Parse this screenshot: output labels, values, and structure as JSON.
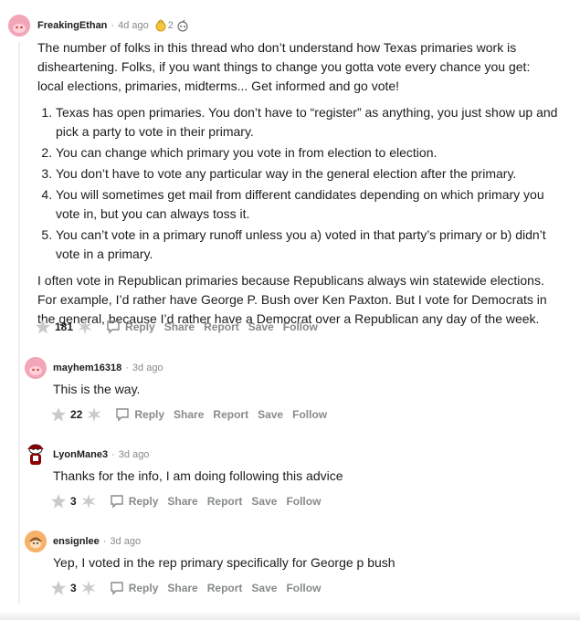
{
  "colors": {
    "accent": "#ff4500",
    "meta": "#878a8c",
    "text": "#1c1c1c",
    "line": "#edeff1"
  },
  "comments": [
    {
      "username": "FreakingEthan",
      "separator": "·",
      "time": "4d ago",
      "award_count": "2",
      "avatar_color": "#f3a5b8",
      "intro": "The number of folks in this thread who don’t understand how Texas primaries work is disheartening. Folks, if you want things to change you gotta vote every chance you get: local elections, primaries, midterms... Get informed and go vote!",
      "list": [
        "Texas has open primaries. You don’t have to “register” as anything, you just show up and pick a party to vote in their primary.",
        "You can change which primary you vote in from election to election.",
        "You don’t have to vote any particular way in the general election after the primary.",
        "You will sometimes get mail from different candidates depending on which primary you vote in, but you can always toss it.",
        "You can’t vote in a primary runoff unless you a) voted in that party’s primary or b) didn’t vote in a primary."
      ],
      "outro": "I often vote in Republican primaries because Republicans always win statewide elections. For example, I’d rather have George P. Bush over Ken Paxton. But I vote for Democrats in the general, because I’d rather have a Democrat over a Republican any day of the week.",
      "votes": "181"
    },
    {
      "username": "mayhem16318",
      "separator": "·",
      "time": "3d ago",
      "avatar_color": "#f3a5b8",
      "text": "This is the way.",
      "votes": "22"
    },
    {
      "username": "LyonMane3",
      "separator": "·",
      "time": "3d ago",
      "avatar_color": "#ffffff",
      "text": "Thanks for the info, I am doing following this advice",
      "votes": "3"
    },
    {
      "username": "ensignlee",
      "separator": "·",
      "time": "3d ago",
      "avatar_color": "#f6b26b",
      "text": "Yep, I voted in the rep primary specifically for George p bush",
      "votes": "3"
    }
  ],
  "actions": {
    "reply": "Reply",
    "share": "Share",
    "report": "Report",
    "save": "Save",
    "follow": "Follow"
  },
  "icons": {
    "upvote": "upvote-star-icon",
    "downvote": "downvote-star-icon",
    "reply": "speech-bubble-icon",
    "award": "award-medal-icon"
  }
}
